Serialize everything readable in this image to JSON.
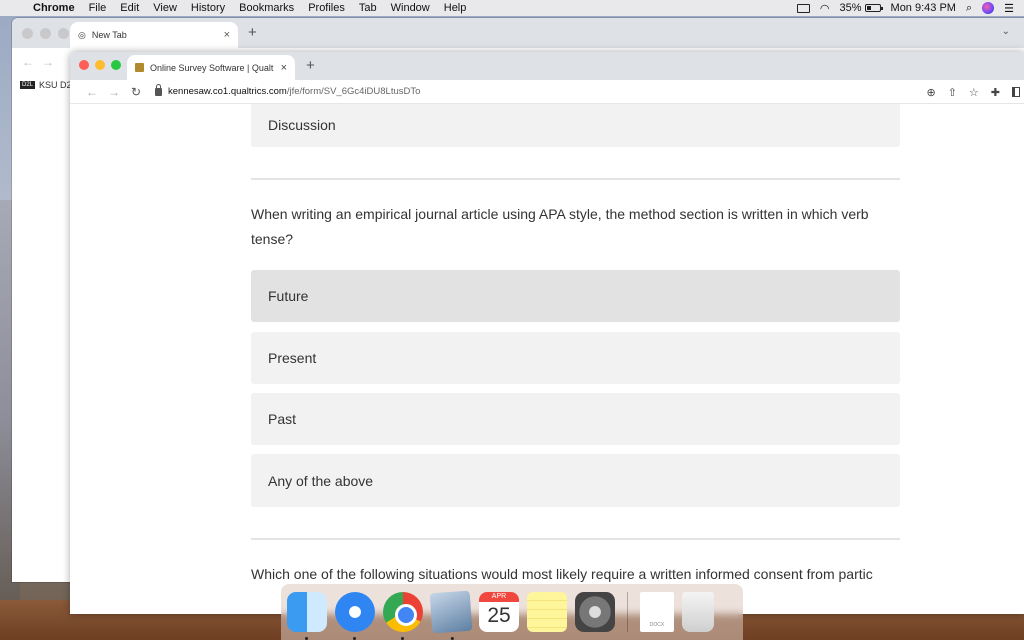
{
  "menubar": {
    "app": "Chrome",
    "items": [
      "File",
      "Edit",
      "View",
      "History",
      "Bookmarks",
      "Profiles",
      "Tab",
      "Window",
      "Help"
    ],
    "battery": "35%",
    "clock": "Mon 9:43 PM"
  },
  "back_window": {
    "tab_title": "New Tab",
    "bookmark": "KSU D2"
  },
  "front_window": {
    "tab_title": "Online Survey Software | Qualt",
    "url_host": "kennesaw.co1.qualtrics.com",
    "url_path": "/jfe/form/SV_6Gc4iDU8LtusDTo"
  },
  "survey": {
    "prev_choice": "Discussion",
    "question1": "When writing an empirical journal article using APA style, the method section is written in which verb tense?",
    "choices": [
      "Future",
      "Present",
      "Past",
      "Any of the above"
    ],
    "hovered_choice": "Future",
    "question2": "Which one of the following situations would most likely require a written informed consent from partic"
  },
  "dock": {
    "calendar_month": "APR",
    "calendar_day": "25",
    "docx_label": "DOCX",
    "icons": [
      "finder-icon",
      "safari-icon",
      "chrome-icon",
      "preview-icon",
      "calendar-icon",
      "notes-icon",
      "system-preferences-icon",
      "docx-file-icon",
      "trash-icon"
    ]
  }
}
